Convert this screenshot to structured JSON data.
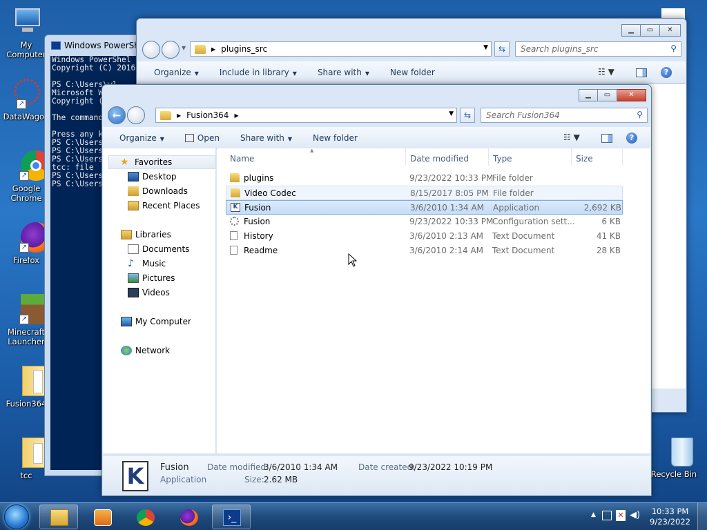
{
  "desktop": {
    "icons": [
      {
        "label": "My Computer",
        "icon": "computer-icon"
      },
      {
        "label": "DataWagon",
        "icon": "datawagon-icon"
      },
      {
        "label": "Google Chrome",
        "icon": "chrome-icon"
      },
      {
        "label": "Firefox",
        "icon": "firefox-icon"
      },
      {
        "label": "Minecraft Launcher",
        "icon": "minecraft-icon"
      },
      {
        "label": "Fusion364",
        "icon": "folder-icon"
      },
      {
        "label": "tcc",
        "icon": "folder-icon"
      },
      {
        "label": "Recycle Bin",
        "icon": "recycle-bin-icon"
      }
    ]
  },
  "powershell": {
    "title": "Windows PowerShell",
    "lines": "Windows PowerShel\nCopyright (C) 2016\n\nPS C:\\Users\\w1\nMicrosoft W\nCopyright (\n\nThe command\n\nPress any k\nPS C:\\Users\nPS C:\\Users\nPS C:\\Users\ntcc: file\nPS C:\\Users\nPS C:\\Users"
  },
  "back_window": {
    "path": "plugins_src",
    "search_placeholder": "Search plugins_src",
    "commands": {
      "organize": "Organize",
      "include": "Include in library",
      "share": "Share with",
      "new_folder": "New folder"
    }
  },
  "front_window": {
    "path": "Fusion364",
    "search_placeholder": "Search Fusion364",
    "commands": {
      "organize": "Organize",
      "open": "Open",
      "share": "Share with",
      "new_folder": "New folder"
    },
    "nav": {
      "favorites": "Favorites",
      "desktop": "Desktop",
      "downloads": "Downloads",
      "recent": "Recent Places",
      "libraries": "Libraries",
      "documents": "Documents",
      "music": "Music",
      "pictures": "Pictures",
      "videos": "Videos",
      "computer": "My Computer",
      "network": "Network"
    },
    "columns": {
      "name": "Name",
      "date": "Date modified",
      "type": "Type",
      "size": "Size"
    },
    "files": [
      {
        "name": "plugins",
        "date": "9/23/2022 10:33 PM",
        "type": "File folder",
        "size": "",
        "icon": "folder"
      },
      {
        "name": "Video Codec",
        "date": "8/15/2017 8:05 PM",
        "type": "File folder",
        "size": "",
        "icon": "folder"
      },
      {
        "name": "Fusion",
        "date": "3/6/2010 1:34 AM",
        "type": "Application",
        "size": "2,692 KB",
        "icon": "app"
      },
      {
        "name": "Fusion",
        "date": "9/23/2022 10:33 PM",
        "type": "Configuration sett...",
        "size": "6 KB",
        "icon": "cfg"
      },
      {
        "name": "History",
        "date": "3/6/2010 2:13 AM",
        "type": "Text Document",
        "size": "41 KB",
        "icon": "txt"
      },
      {
        "name": "Readme",
        "date": "3/6/2010 2:14 AM",
        "type": "Text Document",
        "size": "28 KB",
        "icon": "txt"
      }
    ],
    "details": {
      "name": "Fusion",
      "kind": "Application",
      "modified_label": "Date modified:",
      "modified": "3/6/2010 1:34 AM",
      "size_label": "Size:",
      "size": "2.62 MB",
      "created_label": "Date created:",
      "created": "9/23/2022 10:19 PM"
    }
  },
  "taskbar": {
    "time": "10:33 PM",
    "date": "9/23/2022"
  }
}
